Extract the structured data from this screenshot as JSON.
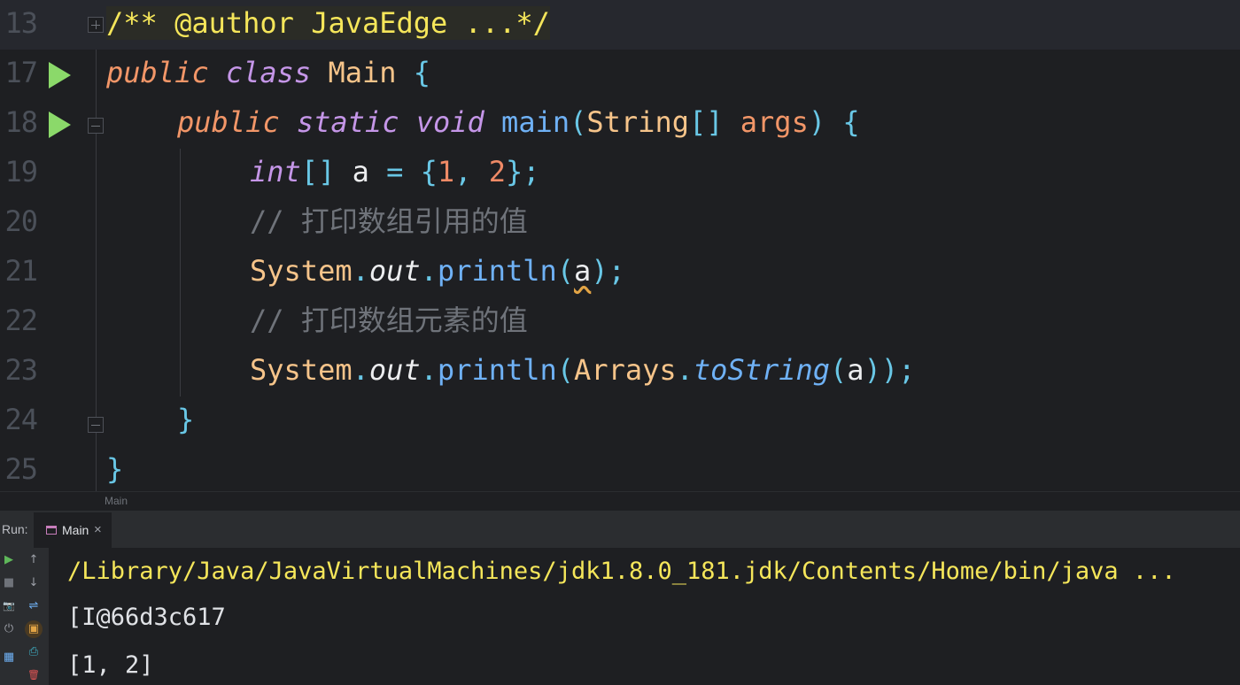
{
  "editor": {
    "lines": [
      {
        "number": "13",
        "tokens": [
          "/** @author JavaEdge ...*/"
        ]
      },
      {
        "number": "17",
        "tokens": [
          "public",
          "class",
          "Main",
          "{"
        ]
      },
      {
        "number": "18",
        "tokens": [
          "public",
          "static",
          "void",
          "main",
          "(",
          "String",
          "[]",
          "args",
          ")",
          "{"
        ]
      },
      {
        "number": "19",
        "tokens": [
          "int",
          "[]",
          "a",
          "=",
          "{",
          "1",
          ",",
          "2",
          "}",
          ";"
        ]
      },
      {
        "number": "20",
        "tokens": [
          "// 打印数组引用的值"
        ]
      },
      {
        "number": "21",
        "tokens": [
          "System",
          ".",
          "out",
          ".",
          "println",
          "(",
          "a",
          ");"
        ]
      },
      {
        "number": "22",
        "tokens": [
          "// 打印数组元素的值"
        ]
      },
      {
        "number": "23",
        "tokens": [
          "System",
          ".",
          "out",
          ".",
          "println",
          "(",
          "Arrays",
          ".",
          "toString",
          "(",
          "a",
          "));"
        ]
      },
      {
        "number": "24",
        "tokens": [
          "}"
        ]
      },
      {
        "number": "25",
        "tokens": [
          "}"
        ]
      }
    ]
  },
  "breadcrumb": {
    "text": "Main"
  },
  "run_panel": {
    "label": "Run:",
    "tab": {
      "label": "Main",
      "close": "×"
    },
    "tools": {
      "rerun": "▶",
      "stop": "■",
      "camera": "📷",
      "plug": "⏻",
      "layout": "▦",
      "up": "↑",
      "down": "↓",
      "wrap": "⇌",
      "pin": "▣",
      "print": "⎙",
      "trash": "🗑"
    },
    "console": [
      "/Library/Java/JavaVirtualMachines/jdk1.8.0_181.jdk/Contents/Home/bin/java ...",
      "[I@66d3c617",
      "[1, 2]"
    ]
  },
  "colors": {
    "background": "#1e1f22",
    "keyword": "#f29668",
    "keyword_secondary": "#c596e8",
    "class_name": "#f6c48a",
    "function": "#6fb1f5",
    "doc_comment": "#f5e65a",
    "run_icon": "#8bd96a"
  }
}
